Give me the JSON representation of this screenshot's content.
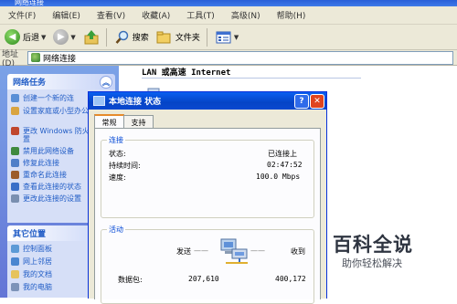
{
  "window": {
    "title": "网络连接"
  },
  "menubar": {
    "items": [
      "文件(F)",
      "编辑(E)",
      "查看(V)",
      "收藏(A)",
      "工具(T)",
      "高级(N)",
      "帮助(H)"
    ]
  },
  "toolbar": {
    "back_label": "后退",
    "search_label": "搜索",
    "folders_label": "文件夹"
  },
  "address": {
    "label": "地址(D)",
    "value": "网络连接"
  },
  "tasks_panel": {
    "title": "网络任务",
    "items": [
      "创建一个新的连",
      "设置家庭或小型办公网络",
      "更改 Windows 防火墙设置",
      "禁用此网络设备",
      "修复此连接",
      "重命名此连接",
      "查看此连接的状态",
      "更改此连接的设置"
    ]
  },
  "places_panel": {
    "title": "其它位置",
    "items": [
      "控制面板",
      "网上邻居",
      "我的文档",
      "我的电脑"
    ]
  },
  "content": {
    "group_title": "LAN 或高速 Internet"
  },
  "dialog": {
    "title": "本地连接 状态",
    "tabs": [
      "常规",
      "支持"
    ],
    "connection": {
      "legend": "连接",
      "rows": [
        {
          "label": "状态:",
          "value": "已连接上"
        },
        {
          "label": "持续时间:",
          "value": "02:47:52"
        },
        {
          "label": "速度:",
          "value": "100.0 Mbps"
        }
      ]
    },
    "activity": {
      "legend": "活动",
      "sent_label": "发送",
      "received_label": "收到",
      "packets_label": "数据包:",
      "sent_value": "207,610",
      "received_value": "400,172"
    }
  },
  "watermark": {
    "brand": "百科全说",
    "tagline": "助你轻松解决"
  },
  "colors": {
    "xp_blue": "#0a48d0",
    "task_link": "#215dc6",
    "dialog_bg": "#ece9d8"
  }
}
